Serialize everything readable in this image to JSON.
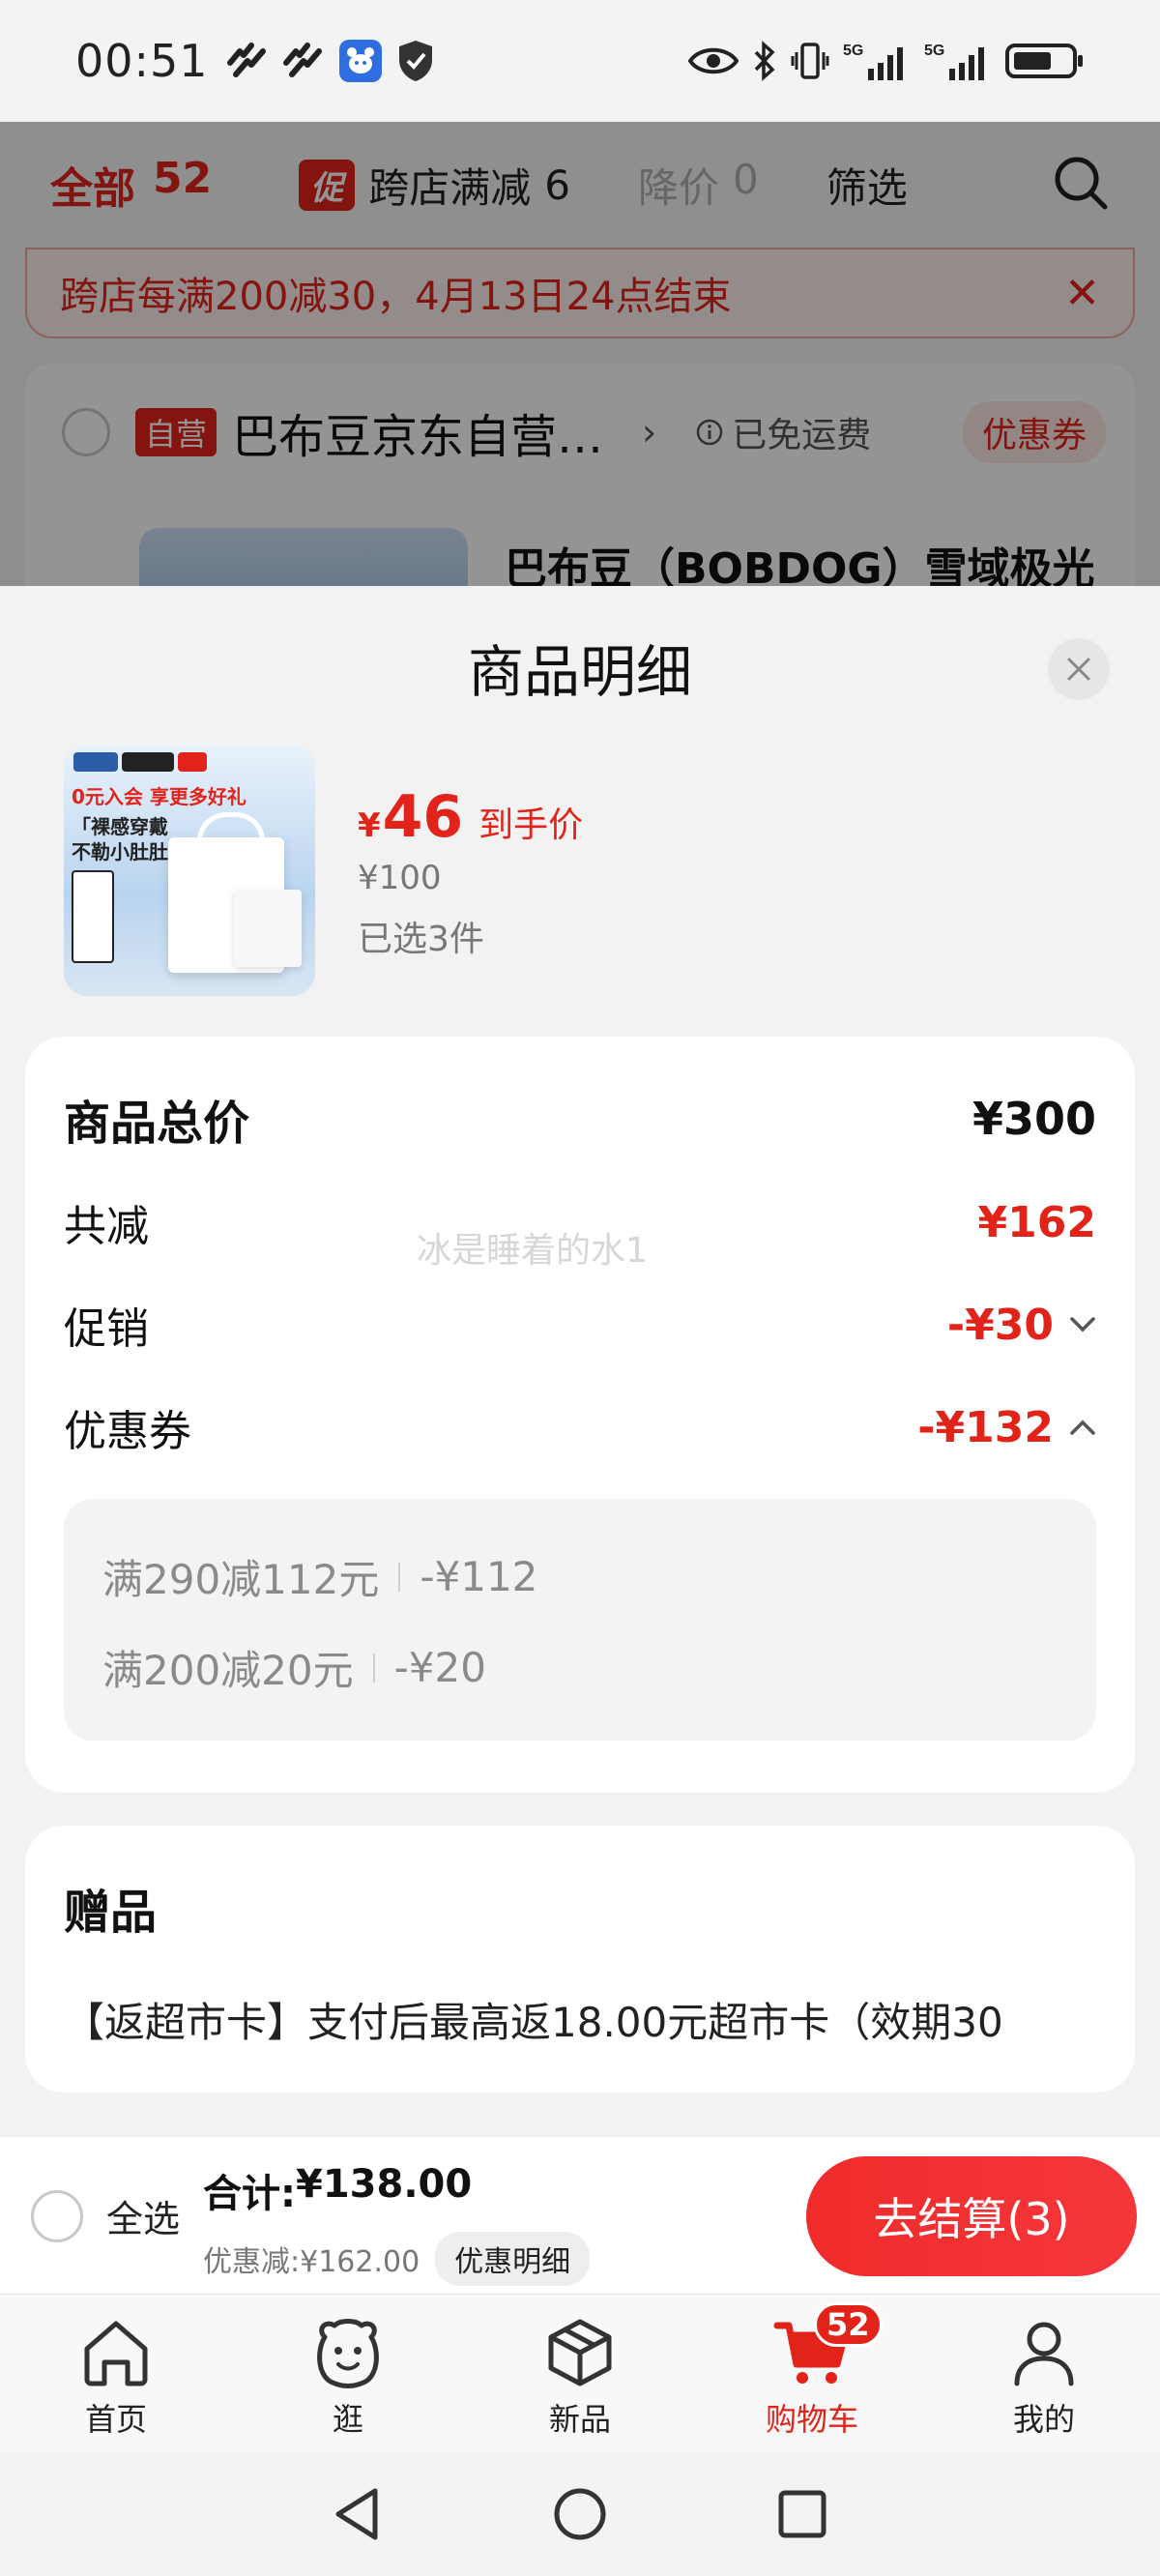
{
  "status_bar": {
    "time": "00:51",
    "network_1": "5G",
    "network_2": "5G"
  },
  "background_cart": {
    "tab_all_label": "全部",
    "tab_all_count": "52",
    "promo_tag": "促",
    "tab_cross_store": "跨店满减",
    "tab_cross_store_count": "6",
    "tab_price_drop": "降价",
    "tab_price_drop_count": "0",
    "tab_filter": "筛选",
    "banner_text": "跨店每满200减30，4月13日24点结束",
    "self_operated_tag": "自营",
    "shop_name": "巴布豆京东自营…",
    "free_shipping": "已免运费",
    "coupon_chip": "优惠券",
    "product_title": "巴布豆（BOBDOG）雪域极光"
  },
  "sheet": {
    "title": "商品明细",
    "product": {
      "image_text_1": "0元入会 享更多好礼",
      "image_text_2": "「裸感穿戴\n不勒小肚肚」",
      "currency": "¥",
      "final_price": "46",
      "final_price_label": "到手价",
      "original_price": "¥100",
      "selected_count": "已选3件"
    },
    "summary": {
      "total_label": "商品总价",
      "total_value": "¥300",
      "reduced_label": "共减",
      "reduced_value": "¥162",
      "promo_label": "促销",
      "promo_value": "-¥30",
      "coupon_label": "优惠券",
      "coupon_value": "-¥132",
      "watermark": "冰是睡着的水1",
      "coupons": [
        {
          "rule": "满290减112元",
          "amount": "-¥112"
        },
        {
          "rule": "满200减20元",
          "amount": "-¥20"
        }
      ]
    },
    "gift": {
      "title": "赠品",
      "text": "【返超市卡】支付后最高返18.00元超市卡（效期30"
    }
  },
  "checkout": {
    "select_all": "全选",
    "total_label": "合计:",
    "total_value": "¥138.00",
    "discount_text": "优惠减:¥162.00",
    "detail_button": "优惠明细",
    "checkout_button": "去结算(3)"
  },
  "bottom_nav": {
    "items": [
      {
        "label": "首页",
        "icon": "home-icon"
      },
      {
        "label": "逛",
        "icon": "browse-icon"
      },
      {
        "label": "新品",
        "icon": "new-product-icon"
      },
      {
        "label": "购物车",
        "icon": "cart-icon",
        "badge": "52"
      },
      {
        "label": "我的",
        "icon": "profile-icon"
      }
    ]
  },
  "colors": {
    "accent": "#e2231a",
    "background": "#f2f2f2"
  }
}
